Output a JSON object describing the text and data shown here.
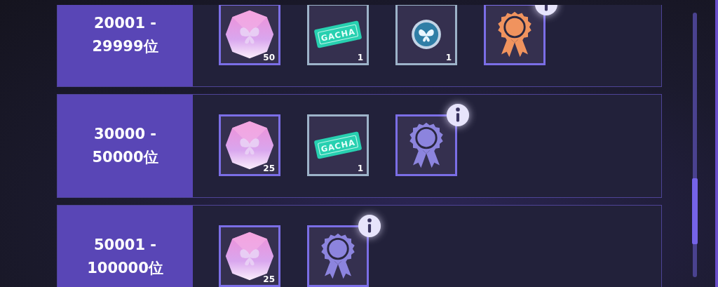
{
  "rows": [
    {
      "rank": "20001 - 29999位",
      "rewards": [
        {
          "kind": "crystal",
          "count": "50"
        },
        {
          "kind": "ticket",
          "label": "GACHA",
          "count": "1"
        },
        {
          "kind": "medal",
          "count": "1"
        },
        {
          "kind": "badge",
          "color": "#f0935e",
          "info": true
        }
      ]
    },
    {
      "rank": "30000 - 50000位",
      "rewards": [
        {
          "kind": "crystal",
          "count": "25"
        },
        {
          "kind": "ticket",
          "label": "GACHA",
          "count": "1"
        },
        {
          "kind": "badge",
          "color": "#8c84de",
          "info": true
        }
      ]
    },
    {
      "rank": "50001 - 100000位",
      "rewards": [
        {
          "kind": "crystal",
          "count": "25"
        },
        {
          "kind": "badge",
          "color": "#8c84de",
          "info": true
        }
      ]
    }
  ]
}
